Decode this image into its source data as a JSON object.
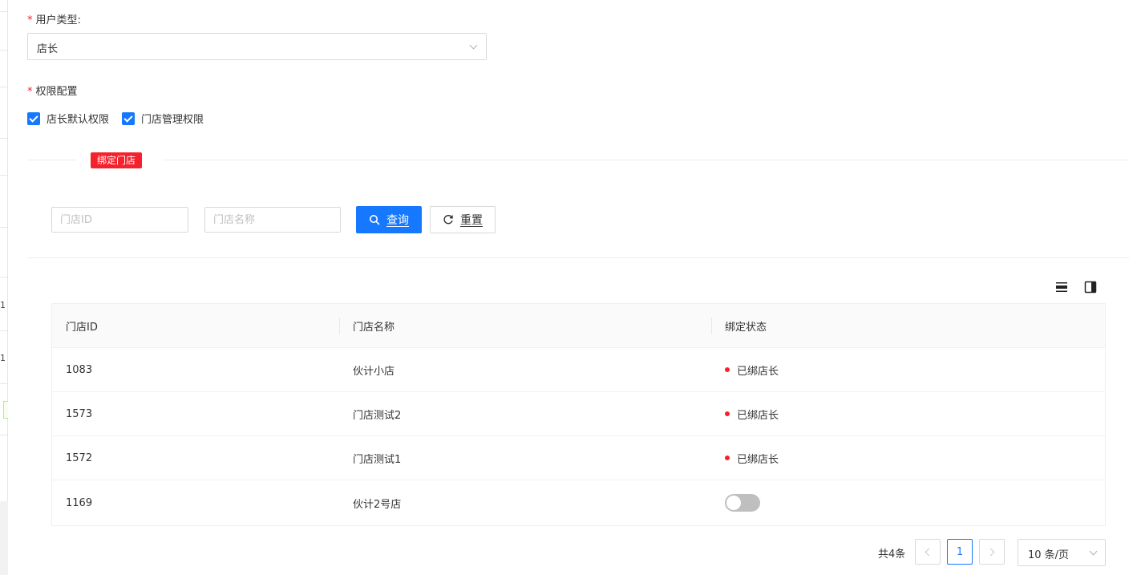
{
  "form": {
    "user_type_label": "用户类型:",
    "user_type_value": "店长",
    "permission_label": "权限配置",
    "permissions": [
      {
        "label": "店长默认权限",
        "checked": true
      },
      {
        "label": "门店管理权限",
        "checked": true
      }
    ],
    "required_mark": "*"
  },
  "section": {
    "bind_store_tag": "绑定门店"
  },
  "search": {
    "store_id_placeholder": "门店ID",
    "store_name_placeholder": "门店名称",
    "query_label": "查询",
    "reset_label": "重置"
  },
  "table": {
    "columns": [
      "门店ID",
      "门店名称",
      "绑定状态"
    ],
    "rows": [
      {
        "id": "1083",
        "name": "伙计小店",
        "status": "已绑店长",
        "bound": true
      },
      {
        "id": "1573",
        "name": "门店测试2",
        "status": "已绑店长",
        "bound": true
      },
      {
        "id": "1572",
        "name": "门店测试1",
        "status": "已绑店长",
        "bound": true
      },
      {
        "id": "1169",
        "name": "伙计2号店",
        "status": "",
        "bound": false
      }
    ]
  },
  "pagination": {
    "total_text": "共4条",
    "current_page": "1",
    "page_size": "10 条/页"
  },
  "background_strip": {
    "digits": [
      "1",
      "1"
    ]
  },
  "colors": {
    "primary": "#1677ff",
    "danger": "#f5222d",
    "switch_off": "#bfbfbf"
  }
}
